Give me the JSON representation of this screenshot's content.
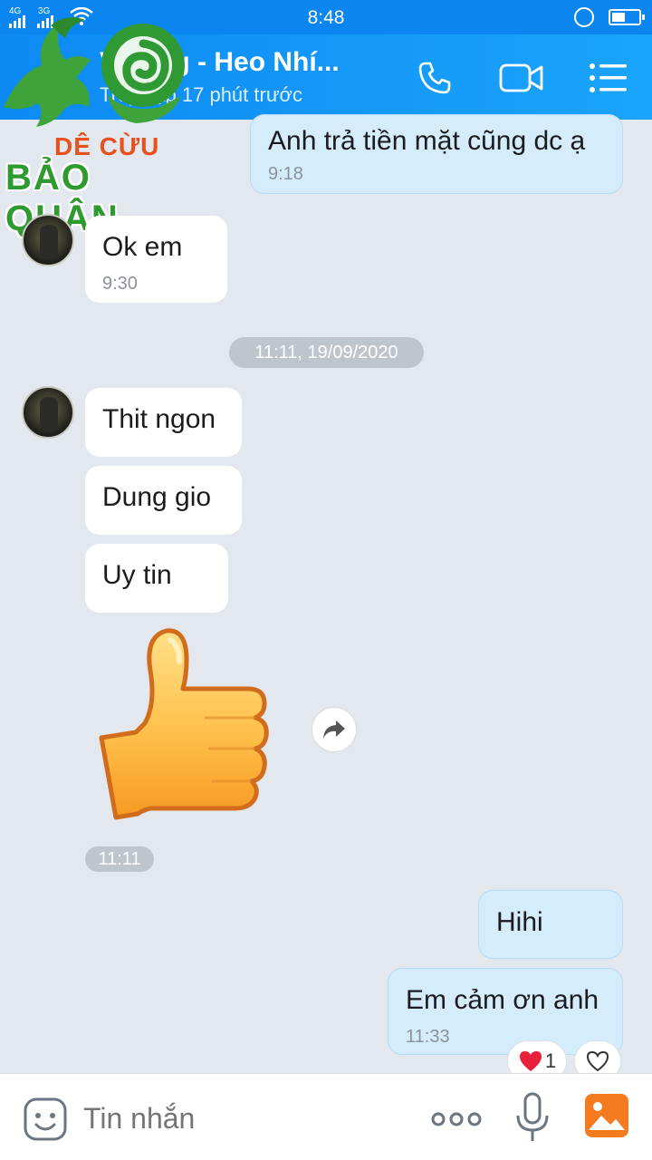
{
  "status_bar": {
    "time": "8:48",
    "network_1": "4G",
    "network_2": "3G"
  },
  "header": {
    "title": "Vương - Heo Nhí...",
    "subtitle": "Truy cập 17 phút trước"
  },
  "logo": {
    "line1": "DÊ CỪU",
    "line2": "BẢO QUÂN"
  },
  "messages": [
    {
      "id": "m1",
      "side": "sent",
      "text": "Anh trả tiền mặt cũng dc ạ",
      "time": "9:18"
    },
    {
      "id": "m2",
      "side": "received",
      "text": "Ok em",
      "time": "9:30"
    },
    {
      "id": "m3",
      "side": "received",
      "text": "Thit ngon"
    },
    {
      "id": "m4",
      "side": "received",
      "text": "Dung gio"
    },
    {
      "id": "m5",
      "side": "received",
      "text": "Uy tin"
    },
    {
      "id": "m6",
      "side": "sent",
      "text": "Hihi"
    },
    {
      "id": "m7",
      "side": "sent",
      "text": "Em cảm ơn anh",
      "time": "11:33"
    }
  ],
  "date_divider": "11:11, 19/09/2020",
  "sticker_time": "11:11",
  "sticker": "thumbs-up",
  "reaction": {
    "icon": "heart",
    "count": "1"
  },
  "composer": {
    "placeholder": "Tin nhắn"
  },
  "colors": {
    "header": "#0b86f0",
    "sent_bubble": "#d4ecfc",
    "received_bubble": "#ffffff",
    "background": "#e3e7ee",
    "gallery_accent": "#f47b20"
  }
}
